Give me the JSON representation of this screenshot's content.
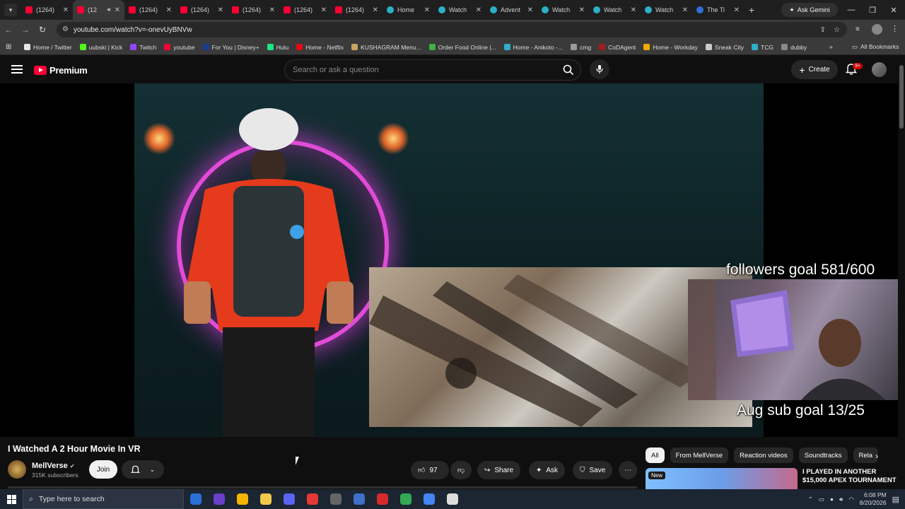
{
  "browser": {
    "tabs": [
      {
        "title": "(1264)",
        "fav": "yt",
        "active": false
      },
      {
        "title": "(12",
        "fav": "yt",
        "active": true
      },
      {
        "title": "(1264)",
        "fav": "yt",
        "active": false
      },
      {
        "title": "(1264)",
        "fav": "yt",
        "active": false
      },
      {
        "title": "(1264)",
        "fav": "yt",
        "active": false
      },
      {
        "title": "(1264)",
        "fav": "yt",
        "active": false
      },
      {
        "title": "(1264)",
        "fav": "yt",
        "active": false
      },
      {
        "title": "Home",
        "fav": "wa",
        "active": false
      },
      {
        "title": "Watch",
        "fav": "wa",
        "active": false
      },
      {
        "title": "Advent",
        "fav": "wa",
        "active": false
      },
      {
        "title": "Watch",
        "fav": "wa",
        "active": false
      },
      {
        "title": "Watch",
        "fav": "wa",
        "active": false
      },
      {
        "title": "Watch",
        "fav": "wa",
        "active": false
      },
      {
        "title": "The Ti",
        "fav": "ti",
        "active": false
      }
    ],
    "ask_gemini": "Ask Gemini",
    "url": "youtube.com/watch?v=-onevUyBNVw",
    "bookmarks": [
      {
        "label": "Home / Twitter",
        "color": "#e6e6e6"
      },
      {
        "label": "uubski | Kick",
        "color": "#53fc18"
      },
      {
        "label": "Twitch",
        "color": "#9146ff"
      },
      {
        "label": "youtube",
        "color": "#ff0033"
      },
      {
        "label": "For You | Disney+",
        "color": "#1a3d8f"
      },
      {
        "label": "Hulu",
        "color": "#1ce783"
      },
      {
        "label": "Home - Netflix",
        "color": "#e50914"
      },
      {
        "label": "KUSHAGRAM Menu...",
        "color": "#c8a45c"
      },
      {
        "label": "Order Food Online |...",
        "color": "#3cb043"
      },
      {
        "label": "Home - Anikoto -...",
        "color": "#2bb0c7"
      },
      {
        "label": "cmg",
        "color": "#9a9a9a"
      },
      {
        "label": "CoDAgent",
        "color": "#a31d1d"
      },
      {
        "label": "Home - Workday",
        "color": "#f2a900"
      },
      {
        "label": "Sneak City",
        "color": "#cccccc"
      },
      {
        "label": "TCG",
        "color": "#2bb0c7"
      },
      {
        "label": "dubby",
        "color": "#8a8a8a"
      }
    ],
    "all_bookmarks": "All Bookmarks"
  },
  "youtube": {
    "logo_text": "Premium",
    "search_placeholder": "Search or ask a question",
    "create_label": "Create",
    "notif_badge": "9+",
    "video": {
      "overlay_followers": "followers goal 581/600",
      "overlay_subs": "Aug sub goal 13/25"
    },
    "video_title": "I Watched A 2 Hour Movie In VR",
    "channel": {
      "name": "MellVerse",
      "subscribers": "315K subscribers"
    },
    "join_label": "Join",
    "likes": "97",
    "share_label": "Share",
    "ask_label": "Ask",
    "save_label": "Save",
    "chips": [
      "All",
      "From MellVerse",
      "Reaction videos",
      "Soundtracks",
      "Rela"
    ],
    "recommended": {
      "badge": "New",
      "title": "I PLAYED IN ANOTHER $15,000 APEX TOURNAMENT"
    }
  },
  "taskbar": {
    "search_placeholder": "Type here to search",
    "time": "6:08 PM",
    "date": "8/20/2026",
    "apps": [
      {
        "name": "task-view",
        "color": "#2a6fd6"
      },
      {
        "name": "app-purple",
        "color": "#6a3fc9"
      },
      {
        "name": "chrome",
        "color": "#f5b400"
      },
      {
        "name": "file-explorer",
        "color": "#f2c94c"
      },
      {
        "name": "discord",
        "color": "#5865f2"
      },
      {
        "name": "media-player",
        "color": "#e53935"
      },
      {
        "name": "app-grey",
        "color": "#666666"
      },
      {
        "name": "app-blue-round",
        "color": "#3f6fc8"
      },
      {
        "name": "app-red-square",
        "color": "#d62b2b"
      },
      {
        "name": "chrome-2",
        "color": "#34a853"
      },
      {
        "name": "chrome-3",
        "color": "#4285f4"
      },
      {
        "name": "clock-app",
        "color": "#dddddd"
      }
    ]
  }
}
